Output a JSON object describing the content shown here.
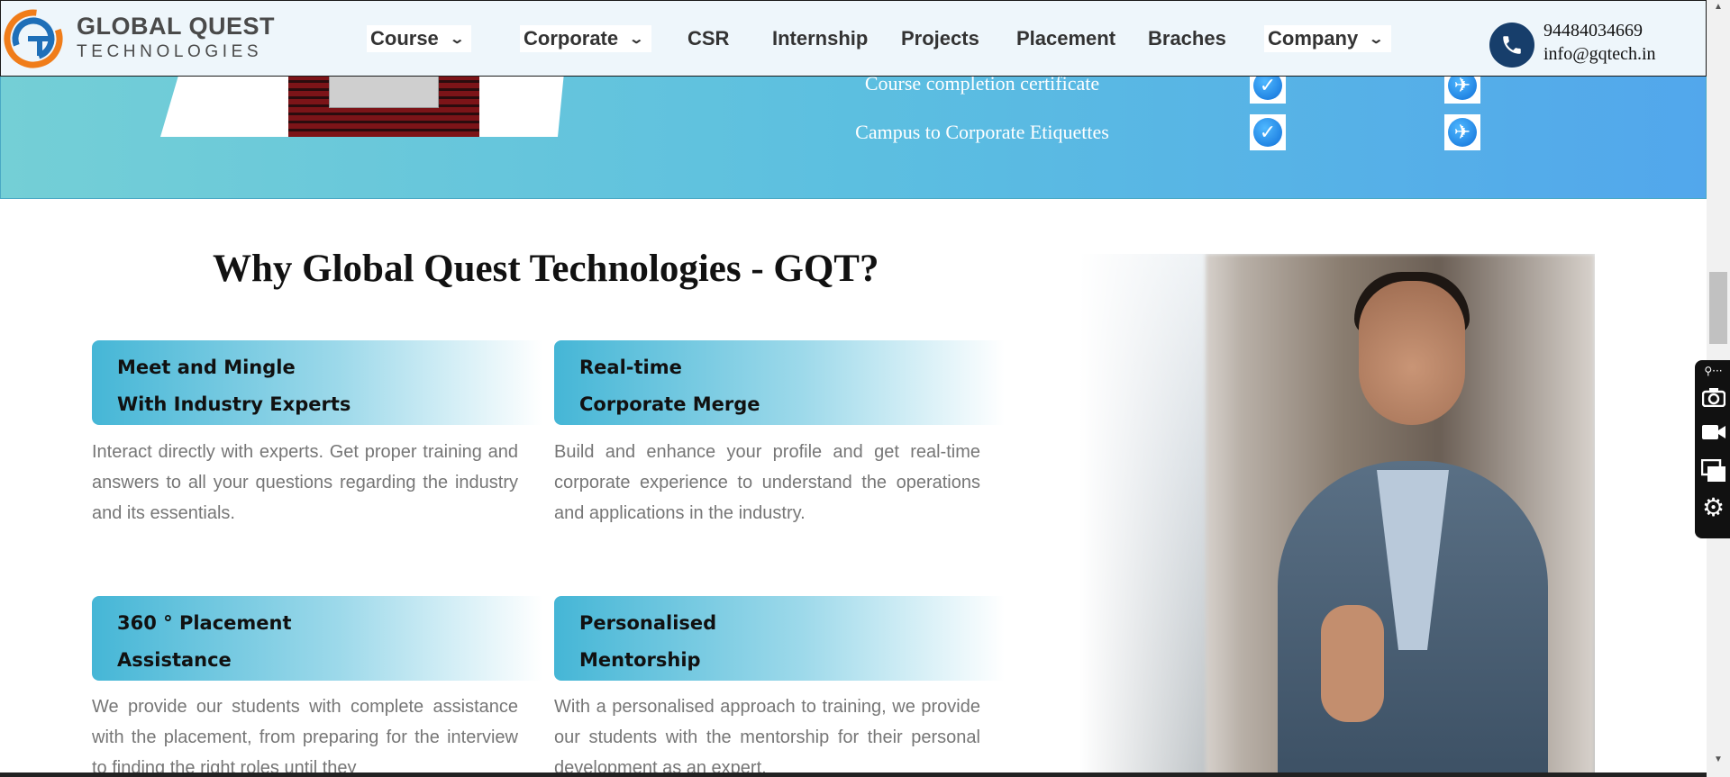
{
  "header": {
    "logo": {
      "line1": "GLOBAL QUEST",
      "line2": "TECHNOLOGIES"
    },
    "nav": [
      {
        "label": "Course",
        "dropdown": true
      },
      {
        "label": "Corporate",
        "dropdown": true
      },
      {
        "label": "CSR",
        "dropdown": false
      },
      {
        "label": "Internship",
        "dropdown": false
      },
      {
        "label": "Projects",
        "dropdown": false
      },
      {
        "label": "Placement",
        "dropdown": false
      },
      {
        "label": "Braches",
        "dropdown": false
      },
      {
        "label": "Company",
        "dropdown": true
      }
    ],
    "chevron": "⌄",
    "contact": {
      "phone": "94484034669",
      "email": "info@gqtech.in"
    }
  },
  "feature_table": {
    "rows": [
      {
        "label": "Course completion certificate",
        "col1": "check",
        "col2": "plane"
      },
      {
        "label": "Campus to Corporate Etiquettes",
        "col1": "check",
        "col2": "plane"
      }
    ]
  },
  "why": {
    "title": "Why Global Quest Technologies - GQT?",
    "cards": [
      {
        "line1": "Meet and Mingle",
        "line2": "With Industry Experts",
        "text": "Interact directly with experts. Get proper training and answers to all your questions regarding the industry and its essentials."
      },
      {
        "line1": "Real-time",
        "line2": "Corporate Merge",
        "text": "Build and enhance your profile and get real-time corporate experience to understand the operations and applications in the industry."
      },
      {
        "line1": "360 ° Placement",
        "line2": "Assistance",
        "text": "We provide our students with complete assistance with the placement, from preparing for the interview to finding the right roles until they"
      },
      {
        "line1": "Personalised",
        "line2": "Mentorship",
        "text": "With a personalised approach to training, we provide our students with the mentorship for their personal development as an expert."
      }
    ]
  },
  "colors": {
    "accent": "#45b6d6",
    "header_bg": "#eef6fb",
    "phone_circle": "#173e6b",
    "band_start": "#74cfd6",
    "band_end": "#52a7ec"
  },
  "toolbar_icons": [
    "screenshot-menu-icon",
    "camera-icon",
    "video-icon",
    "window-icon",
    "gear-icon"
  ]
}
